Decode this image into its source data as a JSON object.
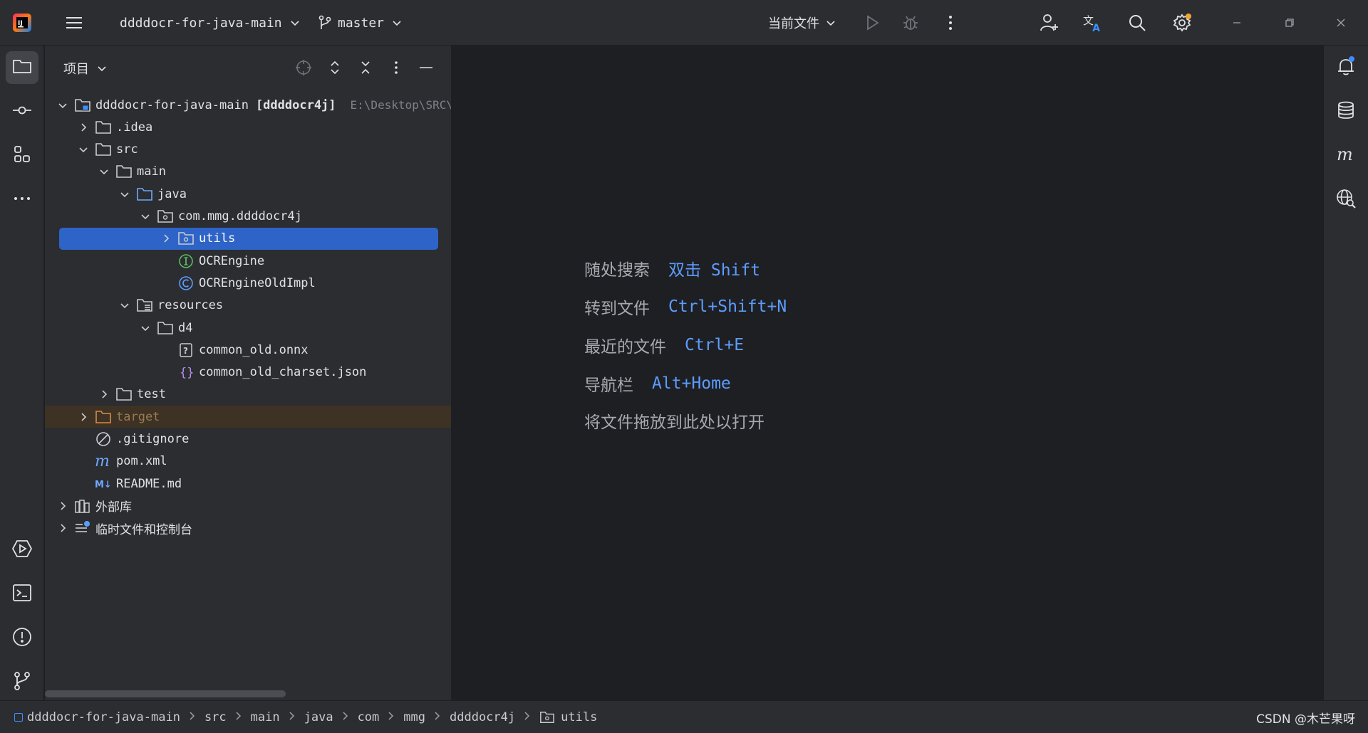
{
  "titlebar": {
    "project_name": "ddddocr-for-java-main",
    "branch": "master",
    "run_config": "当前文件",
    "accent_color": "#f0a732"
  },
  "project_panel": {
    "title": "项目",
    "tree": [
      {
        "label": "ddddocr-for-java-main",
        "bold_suffix": "[ddddocr4j]",
        "path": "E:\\Desktop\\SRC\\",
        "icon": "module-folder-icon",
        "expanded": true,
        "depth": 0
      },
      {
        "label": ".idea",
        "icon": "folder-icon",
        "expanded": false,
        "depth": 1
      },
      {
        "label": "src",
        "icon": "folder-icon",
        "expanded": true,
        "depth": 1
      },
      {
        "label": "main",
        "icon": "folder-icon",
        "expanded": true,
        "depth": 2
      },
      {
        "label": "java",
        "icon": "source-folder-icon",
        "expanded": true,
        "depth": 3
      },
      {
        "label": "com.mmg.ddddocr4j",
        "icon": "package-icon",
        "expanded": true,
        "depth": 4
      },
      {
        "label": "utils",
        "icon": "package-icon",
        "expanded": false,
        "depth": 5,
        "selected": true
      },
      {
        "label": "OCREngine",
        "icon": "interface-icon",
        "depth": 5
      },
      {
        "label": "OCREngineOldImpl",
        "icon": "class-icon",
        "depth": 5
      },
      {
        "label": "resources",
        "icon": "resources-folder-icon",
        "expanded": true,
        "depth": 3
      },
      {
        "label": "d4",
        "icon": "folder-icon",
        "expanded": true,
        "depth": 4
      },
      {
        "label": "common_old.onnx",
        "icon": "unknown-file-icon",
        "depth": 5
      },
      {
        "label": "common_old_charset.json",
        "icon": "json-file-icon",
        "depth": 5
      },
      {
        "label": "test",
        "icon": "folder-icon",
        "expanded": false,
        "depth": 2
      },
      {
        "label": "target",
        "icon": "excluded-folder-icon",
        "expanded": false,
        "depth": 1,
        "excluded": true
      },
      {
        "label": ".gitignore",
        "icon": "ignore-file-icon",
        "depth": 1
      },
      {
        "label": "pom.xml",
        "icon": "maven-icon",
        "depth": 1
      },
      {
        "label": "README.md",
        "icon": "markdown-icon",
        "depth": 1
      },
      {
        "label": "外部库",
        "icon": "library-icon",
        "expanded": false,
        "depth": 0
      },
      {
        "label": "临时文件和控制台",
        "icon": "scratch-icon",
        "expanded": false,
        "depth": 0
      }
    ]
  },
  "editor": {
    "hints": [
      {
        "label": "随处搜索",
        "key": "双击 Shift"
      },
      {
        "label": "转到文件",
        "key": "Ctrl+Shift+N"
      },
      {
        "label": "最近的文件",
        "key": "Ctrl+E"
      },
      {
        "label": "导航栏",
        "key": "Alt+Home"
      },
      {
        "label": "将文件拖放到此处以打开",
        "key": ""
      }
    ]
  },
  "statusbar": {
    "breadcrumbs": [
      "ddddocr-for-java-main",
      "src",
      "main",
      "java",
      "com",
      "mmg",
      "ddddocr4j",
      "utils"
    ],
    "watermark": "CSDN @木芒果呀"
  }
}
